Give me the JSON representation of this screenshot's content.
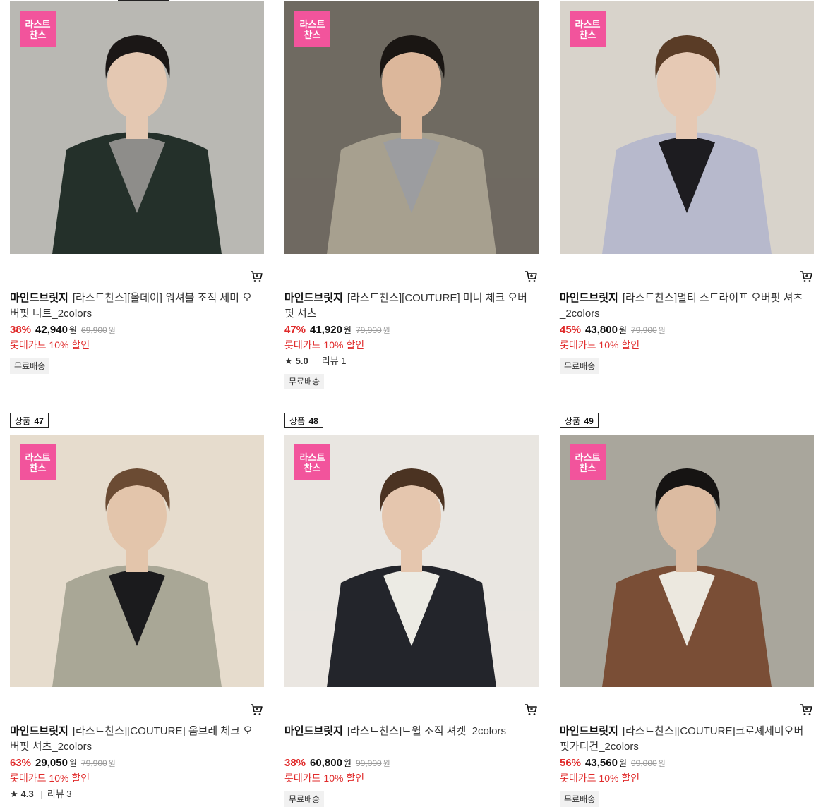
{
  "badge": {
    "line1": "라스트",
    "line2": "찬스"
  },
  "products": [
    {
      "rank_label": "",
      "rank_num": "",
      "brand": "마인드브릿지",
      "name": "[라스트찬스][올데이] 워셔블 조직 세미 오버핏 니트_2colors",
      "discount": "38%",
      "price": "42,940",
      "won": "원",
      "original": "69,900",
      "original_won": "원",
      "promo": "롯데카드 10% 할인",
      "rating": null,
      "reviews": null,
      "shipping": "무료배송",
      "colors": {
        "bg": "#b9b8b3",
        "coat": "#24302a",
        "inner": "#8e8d8a",
        "skin": "#e4c8b2",
        "hair": "#1b1716"
      }
    },
    {
      "rank_label": "",
      "rank_num": "",
      "brand": "마인드브릿지",
      "name": "[라스트찬스][COUTURE] 미니 체크 오버핏 셔츠",
      "discount": "47%",
      "price": "41,920",
      "won": "원",
      "original": "79,900",
      "original_won": "원",
      "promo": "롯데카드 10% 할인",
      "rating": "5.0",
      "reviews": "리뷰 1",
      "shipping": "무료배송",
      "colors": {
        "bg": "#6f6a61",
        "coat": "#a7a08f",
        "inner": "#9c9da0",
        "skin": "#dcb79b",
        "hair": "#1a1613"
      }
    },
    {
      "rank_label": "",
      "rank_num": "",
      "brand": "마인드브릿지",
      "name": "[라스트찬스]멀티 스트라이프 오버핏 셔츠_2colors",
      "discount": "45%",
      "price": "43,800",
      "won": "원",
      "original": "79,900",
      "original_won": "원",
      "promo": "롯데카드 10% 할인",
      "rating": null,
      "reviews": null,
      "shipping": "무료배송",
      "colors": {
        "bg": "#d8d3cb",
        "coat": "#b7b9cc",
        "inner": "#1d1c20",
        "skin": "#e6c9b4",
        "hair": "#5a3c26"
      }
    },
    {
      "rank_label": "상품",
      "rank_num": "47",
      "brand": "마인드브릿지",
      "name": "[라스트찬스][COUTURE] 옴브레 체크 오버핏 셔츠_2colors",
      "discount": "63%",
      "price": "29,050",
      "won": "원",
      "original": "79,900",
      "original_won": "원",
      "promo": "롯데카드 10% 할인",
      "rating": "4.3",
      "reviews": "리뷰 3",
      "shipping": "",
      "colors": {
        "bg": "#e6dccd",
        "coat": "#a9a796",
        "inner": "#1b1b1d",
        "skin": "#e3c5ab",
        "hair": "#6b4b33"
      }
    },
    {
      "rank_label": "상품",
      "rank_num": "48",
      "brand": "마인드브릿지",
      "name": "[라스트찬스]트윌 조직 셔켓_2colors",
      "discount": "38%",
      "price": "60,800",
      "won": "원",
      "original": "99,000",
      "original_won": "원",
      "promo": "롯데카드 10% 할인",
      "rating": null,
      "reviews": null,
      "shipping": "무료배송",
      "colors": {
        "bg": "#e9e6e1",
        "coat": "#23252b",
        "inner": "#ecebe4",
        "skin": "#e5c6ae",
        "hair": "#4b3322"
      }
    },
    {
      "rank_label": "상품",
      "rank_num": "49",
      "brand": "마인드브릿지",
      "name": "[라스트찬스][COUTURE]크로셰세미오버핏가디건_2colors",
      "discount": "56%",
      "price": "43,560",
      "won": "원",
      "original": "99,000",
      "original_won": "원",
      "promo": "롯데카드 10% 할인",
      "rating": null,
      "reviews": null,
      "shipping": "무료배송",
      "colors": {
        "bg": "#a9a69c",
        "coat": "#7a4e36",
        "inner": "#ece8df",
        "skin": "#dcbba1",
        "hair": "#161413"
      }
    }
  ]
}
